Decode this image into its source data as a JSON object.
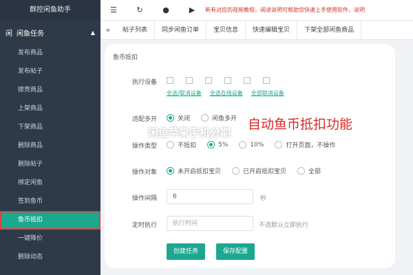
{
  "sidebar": {
    "title": "群控闲鱼助手",
    "section": {
      "icon": "闲",
      "label": "闲鱼任务"
    },
    "items": [
      {
        "label": "发布商品"
      },
      {
        "label": "发布帖子"
      },
      {
        "label": "擦亮商品"
      },
      {
        "label": "上架商品"
      },
      {
        "label": "下架商品"
      },
      {
        "label": "删除商品"
      },
      {
        "label": "删除帖子"
      },
      {
        "label": "绑定闲鱼"
      },
      {
        "label": "签到鱼币"
      },
      {
        "label": "鱼币抵扣"
      },
      {
        "label": "一键降价"
      },
      {
        "label": "删除动态"
      }
    ]
  },
  "topbar": {
    "notice": "新有对应的视频教程，阅读说明可帮助您快速上手使用软件，说明"
  },
  "tabs": [
    {
      "label": "帖子列表"
    },
    {
      "label": "同步闲鱼订单"
    },
    {
      "label": "宝贝信息"
    },
    {
      "label": "快速编辑宝贝"
    },
    {
      "label": "下架全部闲鱼商品"
    }
  ],
  "panel": {
    "title": "鱼币抵扣",
    "device_label": "执行设备",
    "device_links": [
      "全选/取消设备",
      "全选在线设备",
      "全部取消设备"
    ],
    "multi_label": "适配多开",
    "multi_options": [
      "关闭",
      "闲鱼多开"
    ],
    "type_label": "操作类型",
    "type_options": [
      "不抵扣",
      "5%",
      "10%",
      "打开页面，不操作"
    ],
    "object_label": "操作对象",
    "object_options": [
      "未开启抵扣宝贝",
      "已开启抵扣宝贝",
      "全部"
    ],
    "interval_label": "操作间隔",
    "interval_value": "6",
    "interval_unit": "秒",
    "timer_label": "定时执行",
    "timer_placeholder": "执行时间",
    "timer_hint": "不选默认立即执行",
    "create_button": "创建任务",
    "save_button": "保存配置"
  },
  "overlay": {
    "red_text": "自动鱼币抵扣功能",
    "white_text": "闲鱼苹果手机分期"
  }
}
